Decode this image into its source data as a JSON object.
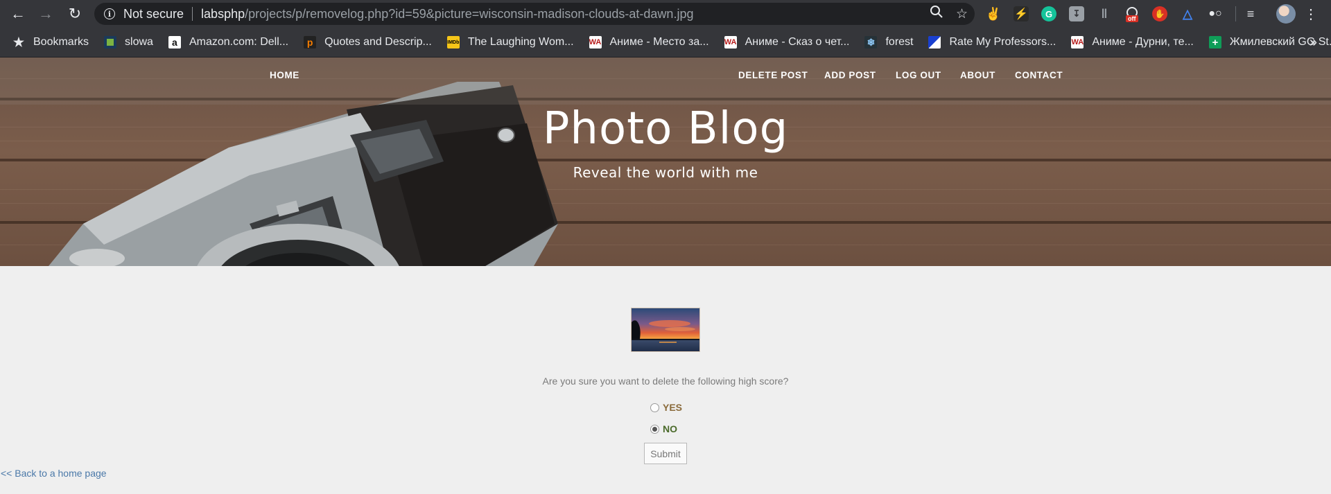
{
  "browser": {
    "security_label": "Not secure",
    "url_host": "labsphp",
    "url_path": "/projects/p/removelog.php?id=59&picture=wisconsin-madison-clouds-at-dawn.jpg",
    "icons": [
      "back-icon",
      "forward-icon",
      "reload-icon",
      "info-icon",
      "zoom-icon",
      "star-icon",
      "profile-avatar",
      "menu-icon"
    ],
    "extension_badge": "off"
  },
  "bookmarks": [
    {
      "label": "Bookmarks",
      "icon": "star",
      "color": "#e8eaed"
    },
    {
      "label": "slowa",
      "icon": "square",
      "color": "#7cb342"
    },
    {
      "label": "Amazon.com: Dell...",
      "icon": "a",
      "color": "#ffffff"
    },
    {
      "label": "Quotes and Descrip...",
      "icon": "p",
      "color": "#f57c00"
    },
    {
      "label": "The Laughing Wom...",
      "icon": "IMDb",
      "color": "#f5c518"
    },
    {
      "label": "Аниме - Место за...",
      "icon": "WA",
      "color": "#ffffff"
    },
    {
      "label": "Аниме - Сказ о чет...",
      "icon": "WA",
      "color": "#ffffff"
    },
    {
      "label": "forest",
      "icon": "snow",
      "color": "#1e88e5"
    },
    {
      "label": "Rate My Professors...",
      "icon": "rmp",
      "color": "#1a73e8"
    },
    {
      "label": "Аниме - Дурни, те...",
      "icon": "WA",
      "color": "#ffffff"
    },
    {
      "label": "Жмилевский GG St...",
      "icon": "plus",
      "color": "#0f9d58"
    }
  ],
  "bookmarks_more": "»",
  "site": {
    "nav": {
      "home": "HOME",
      "delete_post": "DELETE POST",
      "add_post": "ADD POST",
      "log_out": "LOG OUT",
      "about": "ABOUT",
      "contact": "CONTACT"
    },
    "title": "Photo Blog",
    "subtitle": "Reveal the world with me"
  },
  "form": {
    "question": "Are you sure you want to delete the following high score?",
    "options": [
      {
        "label": "YES",
        "checked": false
      },
      {
        "label": "NO",
        "checked": true
      }
    ],
    "submit_label": "Submit",
    "back_link": "<< Back to a home page"
  }
}
